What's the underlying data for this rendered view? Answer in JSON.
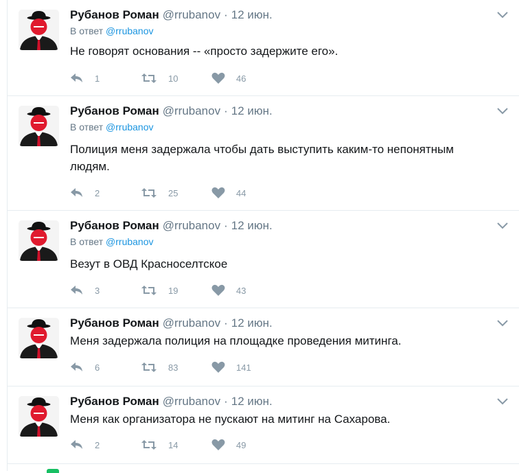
{
  "author": {
    "name": "Рубанов Роман",
    "handle": "@rrubanov"
  },
  "reply_prefix": "В ответ",
  "colors": {
    "link": "#1b95e0",
    "muted": "#657786",
    "icon": "#8899a6",
    "divider": "#e6ecf0"
  },
  "icons": {
    "reply": "reply-icon",
    "retweet": "retweet-icon",
    "like": "heart-icon",
    "menu": "chevron-down-icon",
    "avatar": "bowler-hat-avatar"
  },
  "tweets": [
    {
      "time": "12 июн.",
      "reply_to": "@rrubanov",
      "text": "Не говорят основания -- «просто задержите его».",
      "replies": "1",
      "retweets": "10",
      "likes": "46"
    },
    {
      "time": "12 июн.",
      "reply_to": "@rrubanov",
      "text": "Полиция меня задержала чтобы дать выступить каким-то непонятным людям.",
      "replies": "2",
      "retweets": "25",
      "likes": "44"
    },
    {
      "time": "12 июн.",
      "reply_to": "@rrubanov",
      "text": "Везут в ОВД Красноселтское",
      "replies": "3",
      "retweets": "19",
      "likes": "43"
    },
    {
      "time": "12 июн.",
      "reply_to": "",
      "text": "Меня задержала полиция на площадке проведения митинга.",
      "replies": "6",
      "retweets": "83",
      "likes": "141"
    },
    {
      "time": "12 июн.",
      "reply_to": "",
      "text": "Меня как организатора не пускают на митинг на Сахарова.",
      "replies": "2",
      "retweets": "14",
      "likes": "49"
    }
  ]
}
